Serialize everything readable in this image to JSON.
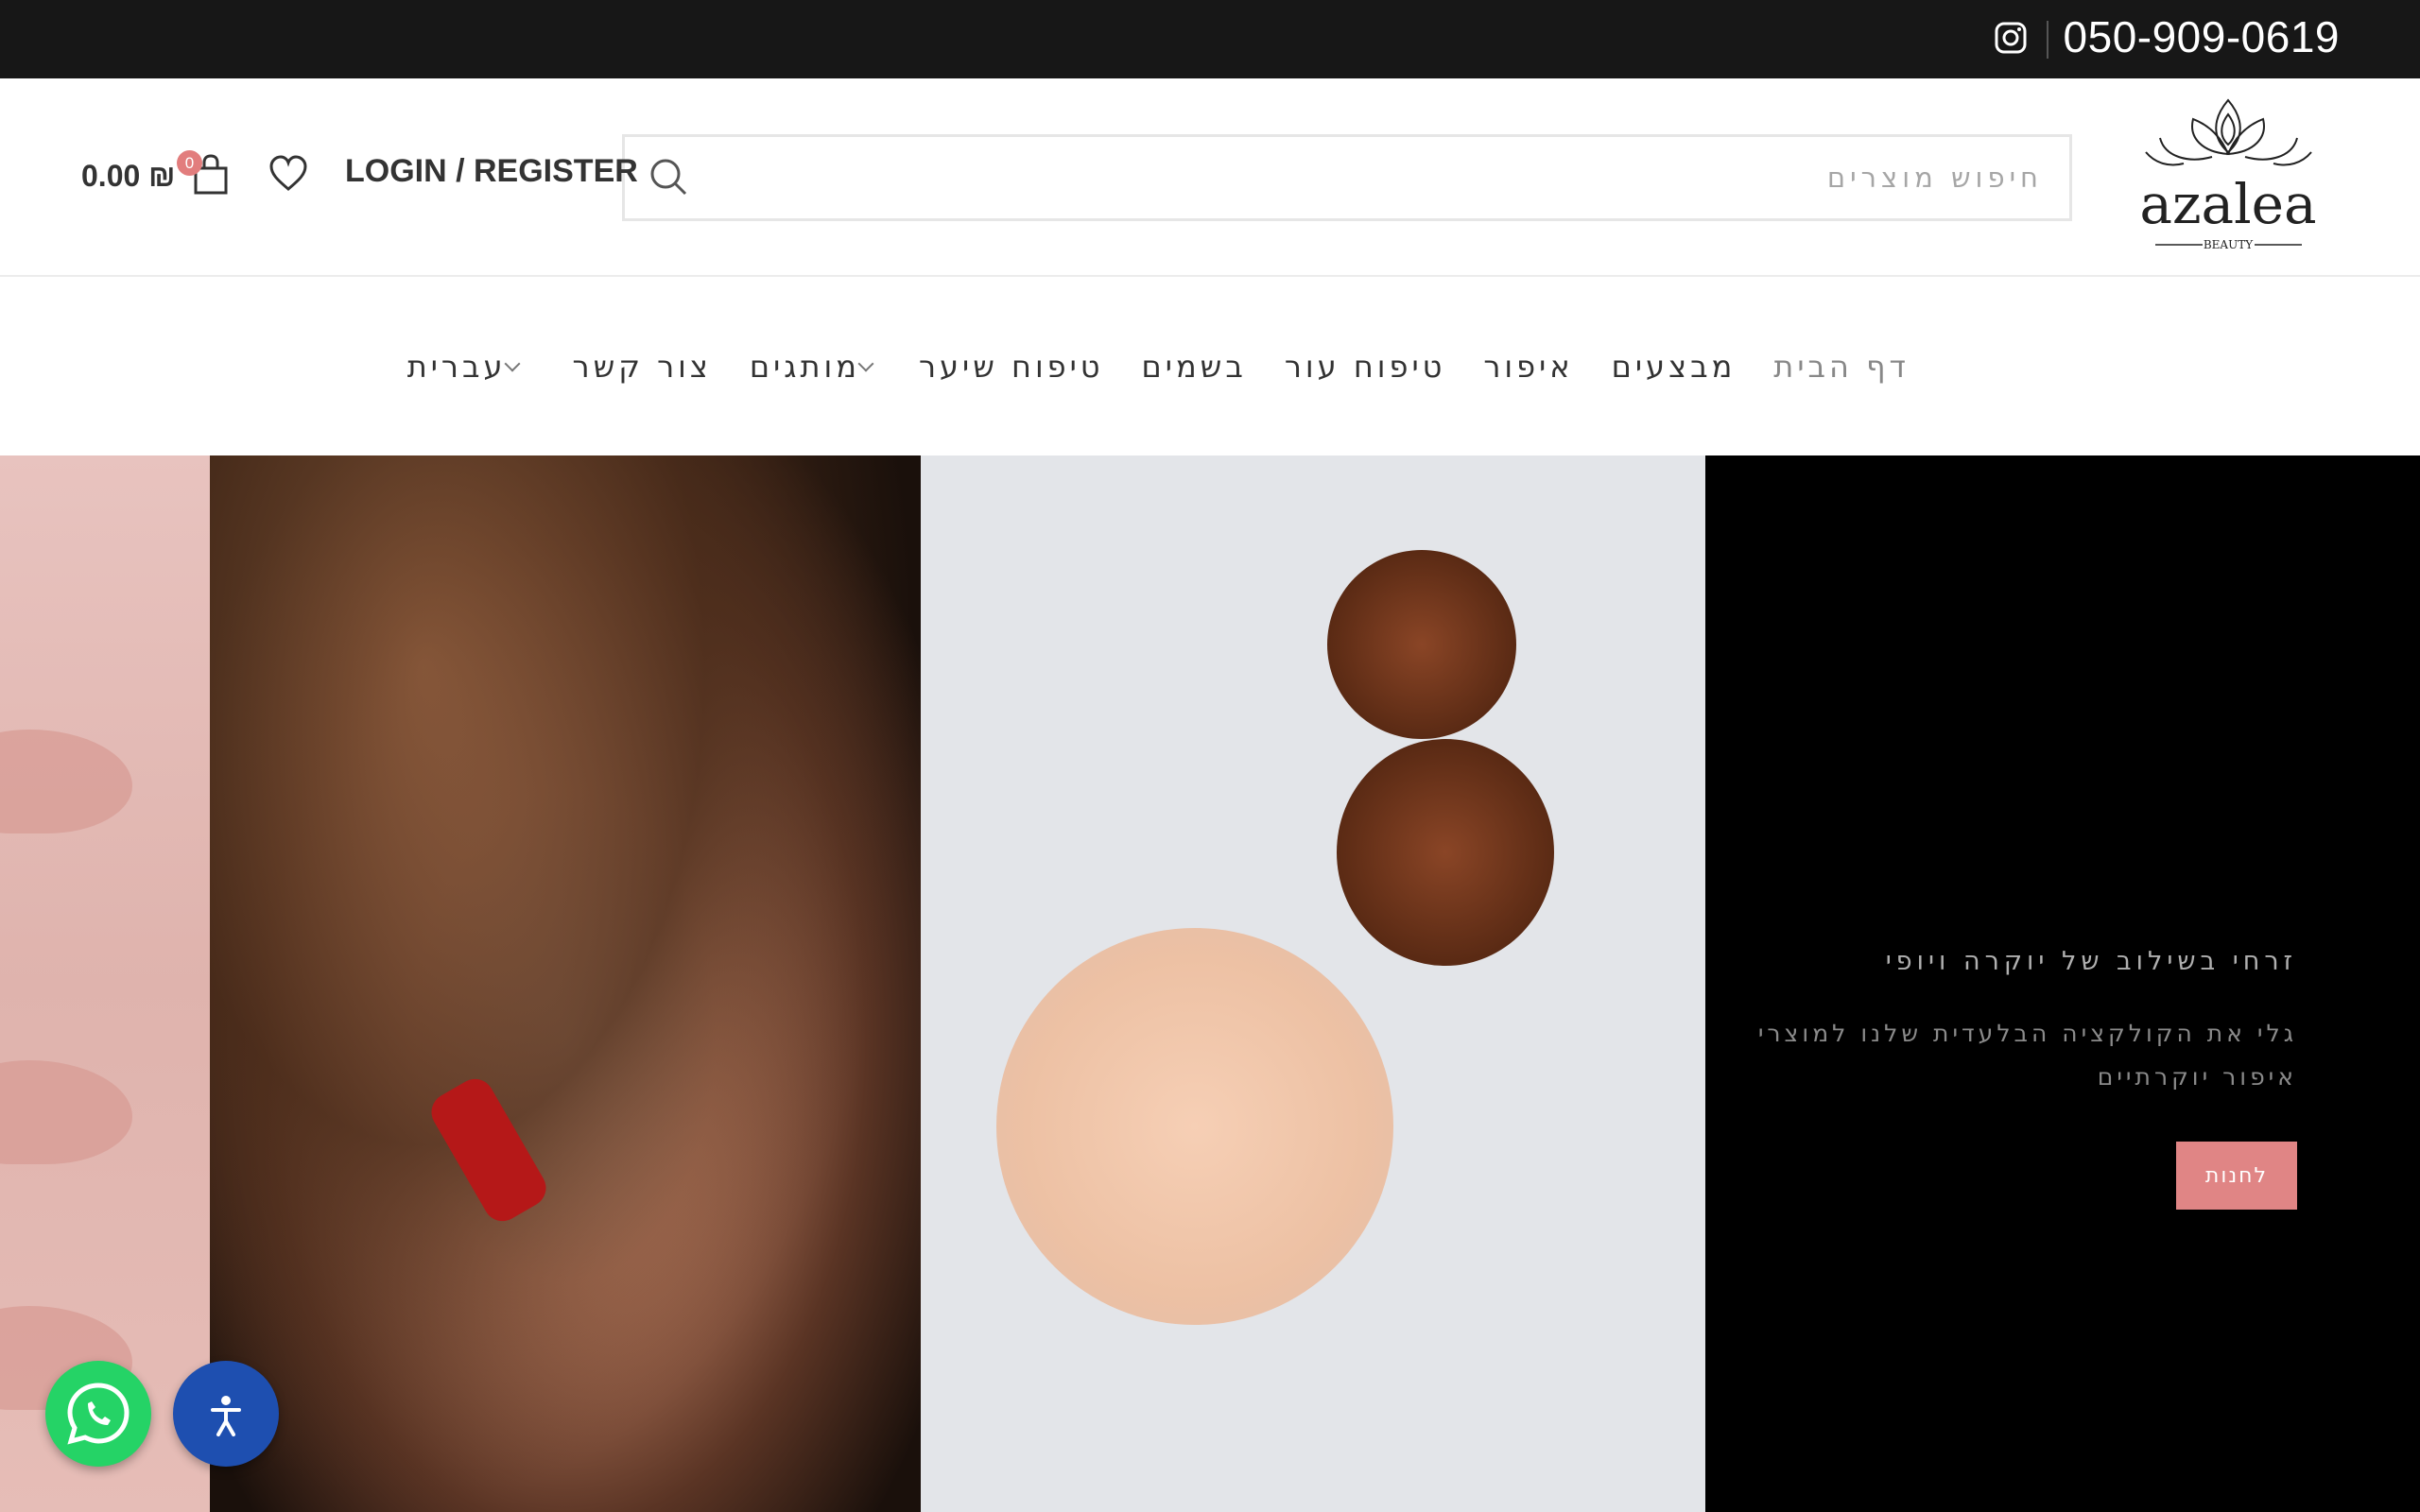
{
  "topbar": {
    "phone": "050-909-0619",
    "social_icon": "instagram-icon"
  },
  "header": {
    "logo_text": "azalea",
    "logo_sub": "BEAUTY",
    "search_placeholder": "חיפוש מוצרים",
    "login_label": "LOGIN / REGISTER",
    "cart_count": "0",
    "cart_total": "0.00 ₪"
  },
  "nav": {
    "items": [
      {
        "label": "דף הבית"
      },
      {
        "label": "מבצעים"
      },
      {
        "label": "איפור"
      },
      {
        "label": "טיפוח עור"
      },
      {
        "label": "בשמים"
      },
      {
        "label": "טיפוח שיער"
      },
      {
        "label": "מותגים"
      },
      {
        "label": "צור קשר"
      },
      {
        "label": "עברית"
      }
    ]
  },
  "hero": {
    "title": "זרחי בשילוב של יוקרה ויופי",
    "desc": "גלי את הקולקציה הבלעדית שלנו למוצרי איפור יוקרתיים",
    "button_label": "לחנות"
  },
  "colors": {
    "topbar_bg": "#171717",
    "accent": "#e08585",
    "whatsapp": "#25d366",
    "accessibility": "#1e4fb0"
  }
}
